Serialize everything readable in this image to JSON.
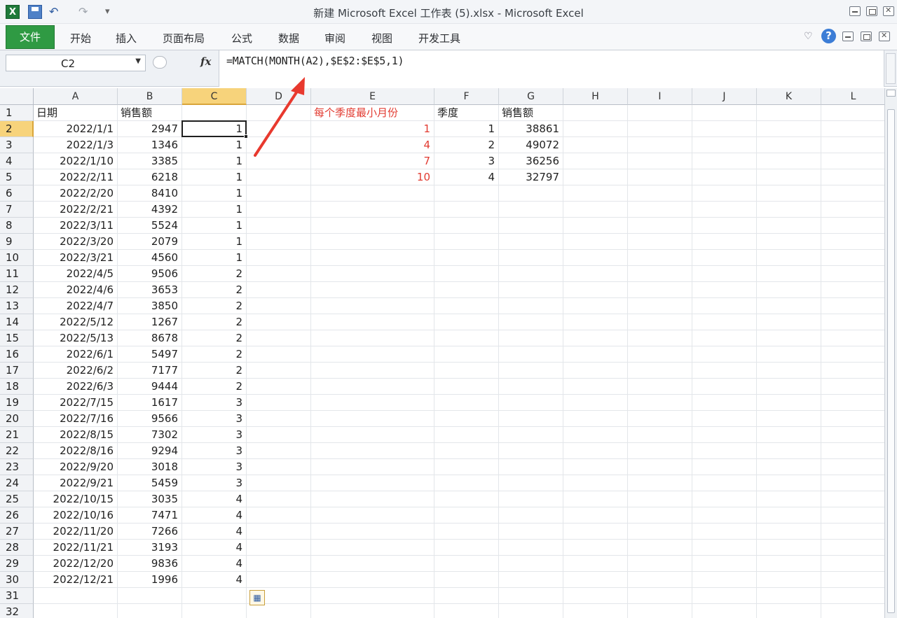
{
  "window": {
    "title": "新建 Microsoft Excel 工作表 (5).xlsx - Microsoft Excel"
  },
  "quick_access": {
    "app_letter": "X",
    "undo": "↶",
    "redo": "↷",
    "dropdown": "▾"
  },
  "ribbon": {
    "file_tab": "文件",
    "tabs": [
      "开始",
      "插入",
      "页面布局",
      "公式",
      "数据",
      "审阅",
      "视图",
      "开发工具"
    ],
    "minimize_ribbon": "♡",
    "help": "?"
  },
  "formula_bar": {
    "name_box": "C2",
    "fx_label": "fx",
    "formula": "=MATCH(MONTH(A2),$E$2:$E$5,1)"
  },
  "columns": [
    "A",
    "B",
    "C",
    "D",
    "E",
    "F",
    "G",
    "H",
    "I",
    "J",
    "K",
    "L"
  ],
  "selected_cell": "C2",
  "headers": {
    "date": "日期",
    "sales": "销售额",
    "quarter_min_month": "每个季度最小月份",
    "quarter": "季度",
    "quarter_sales": "销售额"
  },
  "rows": [
    {
      "date": "2022/1/1",
      "sales": "2947",
      "quarter": "1"
    },
    {
      "date": "2022/1/3",
      "sales": "1346",
      "quarter": "1"
    },
    {
      "date": "2022/1/10",
      "sales": "3385",
      "quarter": "1"
    },
    {
      "date": "2022/2/11",
      "sales": "6218",
      "quarter": "1"
    },
    {
      "date": "2022/2/20",
      "sales": "8410",
      "quarter": "1"
    },
    {
      "date": "2022/2/21",
      "sales": "4392",
      "quarter": "1"
    },
    {
      "date": "2022/3/11",
      "sales": "5524",
      "quarter": "1"
    },
    {
      "date": "2022/3/20",
      "sales": "2079",
      "quarter": "1"
    },
    {
      "date": "2022/3/21",
      "sales": "4560",
      "quarter": "1"
    },
    {
      "date": "2022/4/5",
      "sales": "9506",
      "quarter": "2"
    },
    {
      "date": "2022/4/6",
      "sales": "3653",
      "quarter": "2"
    },
    {
      "date": "2022/4/7",
      "sales": "3850",
      "quarter": "2"
    },
    {
      "date": "2022/5/12",
      "sales": "1267",
      "quarter": "2"
    },
    {
      "date": "2022/5/13",
      "sales": "8678",
      "quarter": "2"
    },
    {
      "date": "2022/6/1",
      "sales": "5497",
      "quarter": "2"
    },
    {
      "date": "2022/6/2",
      "sales": "7177",
      "quarter": "2"
    },
    {
      "date": "2022/6/3",
      "sales": "9444",
      "quarter": "2"
    },
    {
      "date": "2022/7/15",
      "sales": "1617",
      "quarter": "3"
    },
    {
      "date": "2022/7/16",
      "sales": "9566",
      "quarter": "3"
    },
    {
      "date": "2022/8/15",
      "sales": "7302",
      "quarter": "3"
    },
    {
      "date": "2022/8/16",
      "sales": "9294",
      "quarter": "3"
    },
    {
      "date": "2022/9/20",
      "sales": "3018",
      "quarter": "3"
    },
    {
      "date": "2022/9/21",
      "sales": "5459",
      "quarter": "3"
    },
    {
      "date": "2022/10/15",
      "sales": "3035",
      "quarter": "4"
    },
    {
      "date": "2022/10/16",
      "sales": "7471",
      "quarter": "4"
    },
    {
      "date": "2022/11/20",
      "sales": "7266",
      "quarter": "4"
    },
    {
      "date": "2022/11/21",
      "sales": "3193",
      "quarter": "4"
    },
    {
      "date": "2022/12/20",
      "sales": "9836",
      "quarter": "4"
    },
    {
      "date": "2022/12/21",
      "sales": "1996",
      "quarter": "4"
    }
  ],
  "summary": [
    {
      "min_month": "1",
      "quarter": "1",
      "sales": "38861"
    },
    {
      "min_month": "4",
      "quarter": "2",
      "sales": "49072"
    },
    {
      "min_month": "7",
      "quarter": "3",
      "sales": "36256"
    },
    {
      "min_month": "10",
      "quarter": "4",
      "sales": "32797"
    }
  ],
  "row_count": 32,
  "colors": {
    "file_tab": "#2f9a43",
    "selection_header": "#f7d37b",
    "accent_red": "#e23b31",
    "arrow": "#e8392e"
  }
}
